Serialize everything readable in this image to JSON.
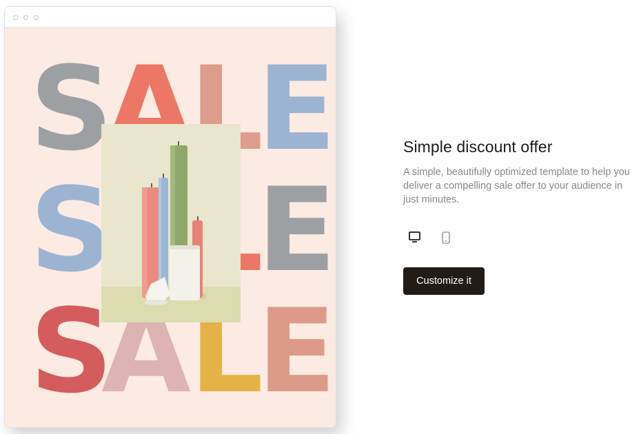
{
  "preview": {
    "sale_rows": [
      {
        "letters": [
          {
            "char": "S",
            "color": "#9da0a3"
          },
          {
            "char": "A",
            "color": "#ec7766"
          },
          {
            "char": "L",
            "color": "#dd9c8c"
          },
          {
            "char": "E",
            "color": "#9cb3d2"
          }
        ]
      },
      {
        "letters": [
          {
            "char": "S",
            "color": "#9cb3d2"
          },
          {
            "char": "A",
            "color": "#ec7766"
          },
          {
            "char": "L",
            "color": "#ec7766"
          },
          {
            "char": "E",
            "color": "#9da0a3"
          }
        ]
      },
      {
        "letters": [
          {
            "char": "S",
            "color": "#d45c5c"
          },
          {
            "char": "A",
            "color": "#ddb3b3"
          },
          {
            "char": "L",
            "color": "#e4b247"
          },
          {
            "char": "E",
            "color": "#dd9a88"
          }
        ]
      }
    ],
    "photo": {
      "icon": "candles-photo",
      "background": "#e9e6cd",
      "floor": "#dcdcb0"
    }
  },
  "info": {
    "title": "Simple discount offer",
    "description": "A simple, beautifully optimized template to help you deliver a compelling sale offer to your audience in just minutes.",
    "device_options": [
      {
        "icon": "desktop-icon",
        "selected": true
      },
      {
        "icon": "mobile-icon",
        "selected": false
      }
    ],
    "cta_label": "Customize it"
  },
  "colors": {
    "page_bg": "#ffffff",
    "preview_bg": "#fcebe3",
    "button_bg": "#231b18",
    "title_text": "#1c1a19",
    "body_text": "#8a8684"
  }
}
